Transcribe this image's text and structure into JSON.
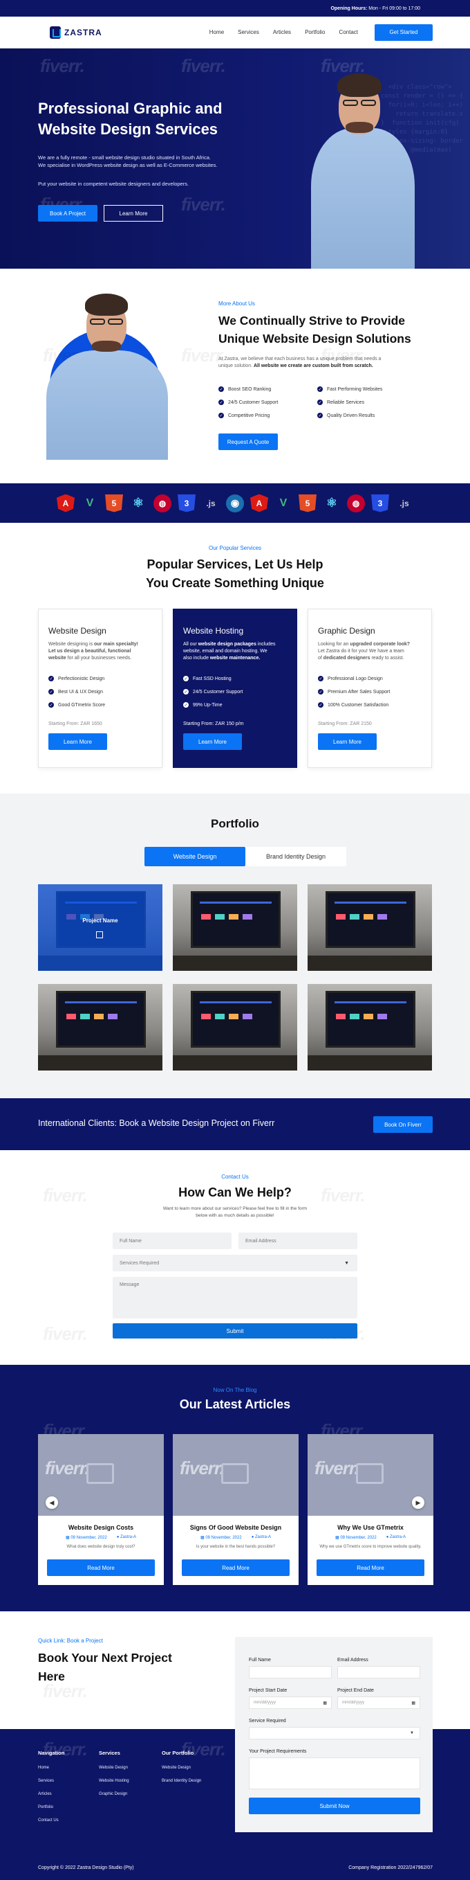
{
  "topbar": {
    "hours_label": "Opening Hours:",
    "hours_value": "Mon - Fri 09:00 to 17:00"
  },
  "header": {
    "brand": "ZASTRA",
    "nav": [
      "Home",
      "Services",
      "Articles",
      "Portfolio",
      "Contact"
    ],
    "cta": "Get Started"
  },
  "hero": {
    "title_line1": "Professional Graphic and",
    "title_line2": "Website Design Services",
    "para1_line1": "We are a fully remote - small website design studio situated in South Africa.",
    "para1_line2": "We specialise in WordPress website design as well as E-Commerce websites.",
    "para2": "Put your website in competent website designers and developers.",
    "btn_primary": "Book A Project",
    "btn_secondary": "Learn More"
  },
  "about": {
    "tag": "More About Us",
    "title_line1": "We Continually Strive to Provide",
    "title_line2": "Unique Website Design Solutions",
    "text_line1": "At Zastra, we believe that each business has a unique problem that needs a",
    "text_plain": "unique solution.",
    "text_bold": "All website we create are custom built from scratch.",
    "features": [
      "Boost SEO Ranking",
      "Fast Performing Websites",
      "24/5 Customer Support",
      "Reliable Services",
      "Competitive Pricing",
      "Quality Driven Results"
    ],
    "button": "Request A Quote"
  },
  "skills": [
    "A",
    "V",
    "5",
    "⚛",
    "◍",
    "3",
    ".js",
    "◉",
    "A",
    "V",
    "5",
    "⚛",
    "◍",
    "3",
    ".js"
  ],
  "services": {
    "tag": "Our Popular Services",
    "title_line1": "Popular Services, Let Us Help",
    "title_line2": "You Create Something Unique",
    "cards": [
      {
        "title": "Website Design",
        "desc_a": "Website designing is ",
        "desc_b": "our main specialty!",
        "desc_c": "Let us design a beautiful, functional",
        "desc_d": "website",
        "desc_e": " for all your businesses needs.",
        "items": [
          "Perfectionistic Design",
          "Best UI & UX Design",
          "Good GTmetrix Score"
        ],
        "price": "Starting From: ZAR 1650",
        "button": "Learn More"
      },
      {
        "title": "Website Hosting",
        "desc_a": "All our ",
        "desc_b": "website design packages",
        "desc_c": " includes",
        "desc_d": "website, email and domain hosting. We",
        "desc_e": "also include ",
        "desc_f": "website maintenance.",
        "items": [
          "Fast SSD Hosting",
          "24/5 Customer Support",
          "99% Up-Time"
        ],
        "price": "Starting From: ZAR 150 p/m",
        "button": "Learn More"
      },
      {
        "title": "Graphic Design",
        "desc_a": "Looking for an ",
        "desc_b": "upgraded corporate look?",
        "desc_c": "Let Zastra do it for you! We have a team",
        "desc_d": "of ",
        "desc_e": "dedicated designers",
        "desc_f": " ready to assist.",
        "items": [
          "Professional Logo Design",
          "Premium After Sales Support",
          "100% Customer Satisfaction"
        ],
        "price": "Starting From: ZAR 2150",
        "button": "Learn More"
      }
    ]
  },
  "portfolio": {
    "title": "Portfolio",
    "tabs": [
      "Website Design",
      "Brand Identity Design"
    ],
    "hover_label": "Project Name"
  },
  "cta_band": {
    "text": "International Clients: Book a Website Design Project on Fiverr",
    "button": "Book On Fiverr"
  },
  "contact": {
    "tag": "Contact Us",
    "title": "How Can We Help?",
    "text_line1": "Want to learn more about our services? Please feel free to fill in the form",
    "text_line2": "below with as much details as possible!",
    "placeholders": {
      "name": "Full Name",
      "email": "Email Address",
      "service": "Services Required",
      "message": "Message"
    },
    "submit": "Submit"
  },
  "blog": {
    "tag": "Now On The Blog",
    "title": "Our Latest Articles",
    "posts": [
      {
        "title": "Website Design Costs",
        "date": "09 November, 2022",
        "author": "Zastra-A",
        "excerpt": "What does website design truly cost?",
        "button": "Read More"
      },
      {
        "title": "Signs Of Good Website Design",
        "date": "09 November, 2022",
        "author": "Zastra-A",
        "excerpt": "Is your website in the best hands possible?",
        "button": "Read More"
      },
      {
        "title": "Why We Use GTmetrix",
        "date": "09 November, 2022",
        "author": "Zastra-A",
        "excerpt": "Why we use GTmetrix score to improve website quality.",
        "button": "Read More"
      }
    ]
  },
  "booking": {
    "tag": "Quick Link: Book a Project",
    "title_line1": "Book Your Next Project",
    "title_line2": "Here",
    "labels": {
      "name": "Full Name",
      "email": "Email Address",
      "start": "Project Start Date",
      "end": "Project End Date",
      "service": "Service Required",
      "requirements": "Your Project Requirements"
    },
    "date_placeholder": "mm/dd/yyyy",
    "submit": "Submit Now"
  },
  "footer": {
    "navigation": {
      "title": "Navigation",
      "items": [
        "Home",
        "Services",
        "Articles",
        "Portfolio",
        "Contact Us"
      ]
    },
    "services": {
      "title": "Services",
      "items": [
        "Website Design",
        "Website Hosting",
        "Graphic Design"
      ]
    },
    "portfolio": {
      "title": "Our Portfolio",
      "items": [
        "Website Design",
        "Brand Identity Design"
      ]
    },
    "copyright": "Copyright © 2022 Zastra Design Studio (Pty)",
    "registration": "Company Registration 2022/247962/07"
  },
  "watermark": "fiverr."
}
